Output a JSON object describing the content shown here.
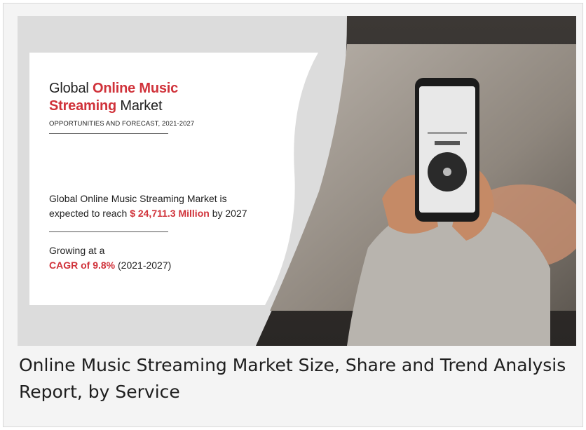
{
  "banner": {
    "title_prefix": "Global",
    "title_highlight_1": "Online Music",
    "title_highlight_2": "Streaming",
    "title_suffix": "Market",
    "subtitle": "OPPORTUNITIES AND FORECAST, 2021-2027",
    "stat1_line1": "Global Online Music Streaming Market is",
    "stat1_line2_prefix": "expected to reach",
    "stat1_value": "$ 24,711.3 Million",
    "stat1_line2_suffix": "by 2027",
    "stat2_line1": "Growing at a",
    "stat2_value": "CAGR of 9.8%",
    "stat2_suffix": "(2021-2027)",
    "accent_color": "#d0323a"
  },
  "caption": {
    "text": "Online Music Streaming Market Size, Share and Trend Analysis Report, by Service"
  }
}
